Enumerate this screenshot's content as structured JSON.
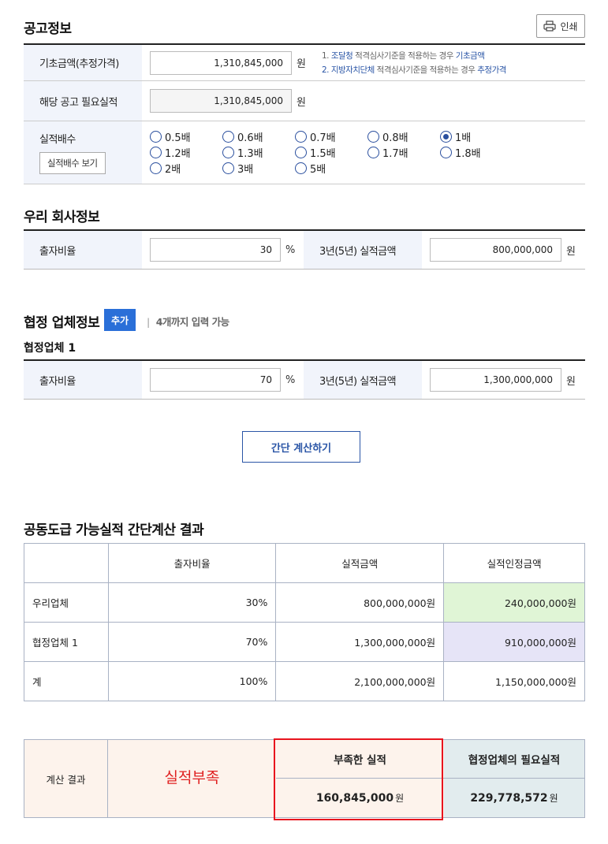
{
  "notice": {
    "title": "공고정보",
    "print_label": "인쇄",
    "base_amount": {
      "label": "기초금액(추정가격)",
      "value": "1,310,845,000",
      "unit": "원"
    },
    "notes": [
      {
        "num": "1.",
        "agency": "조달청",
        "mid": "적격심사기준을 적용하는 경우",
        "target": "기초금액"
      },
      {
        "num": "2.",
        "agency": "지방자치단체",
        "mid": "적격심사기준을 적용하는 경우",
        "target": "추정가격"
      }
    ],
    "required": {
      "label": "해당 공고 필요실적",
      "value": "1,310,845,000",
      "unit": "원"
    },
    "multiplier": {
      "label": "실적배수",
      "view_button": "실적배수 보기",
      "options": [
        "0.5배",
        "0.6배",
        "0.7배",
        "0.8배",
        "1배",
        "1.2배",
        "1.3배",
        "1.5배",
        "1.7배",
        "1.8배",
        "2배",
        "3배",
        "5배"
      ],
      "selected": "1배"
    }
  },
  "company": {
    "title": "우리 회사정보",
    "ratio_label": "출자비율",
    "ratio_value": "30",
    "ratio_unit": "%",
    "amount_label": "3년(5년) 실적금액",
    "amount_value": "800,000,000",
    "amount_unit": "원"
  },
  "partner": {
    "title": "협정 업체정보",
    "add_label": "추가",
    "hint_sep": "|",
    "hint": "4개까지 입력 가능",
    "sub_title": "협정업체 1",
    "ratio_label": "출자비율",
    "ratio_value": "70",
    "ratio_unit": "%",
    "amount_label": "3년(5년) 실적금액",
    "amount_value": "1,300,000,000",
    "amount_unit": "원"
  },
  "calc_button": "간단 계산하기",
  "result": {
    "title": "공동도급 가능실적 간단계산 결과",
    "headers": [
      "",
      "출자비율",
      "실적금액",
      "실적인정금액"
    ],
    "rows": [
      [
        "우리업체",
        "30%",
        "800,000,000원",
        "240,000,000원"
      ],
      [
        "협정업체 1",
        "70%",
        "1,300,000,000원",
        "910,000,000원"
      ],
      [
        "계",
        "100%",
        "2,100,000,000원",
        "1,150,000,000원"
      ]
    ]
  },
  "final": {
    "label": "계산 결과",
    "status": "실적부족",
    "shortage_label": "부족한 실적",
    "shortage_value": "160,845,000",
    "partner_need_label": "협정업체의 필요실적",
    "partner_need_value": "229,778,572",
    "won": "원",
    "colors": {
      "status": "#e02020",
      "highlight": "#e8141e",
      "accent": "#2a6fd8"
    }
  }
}
